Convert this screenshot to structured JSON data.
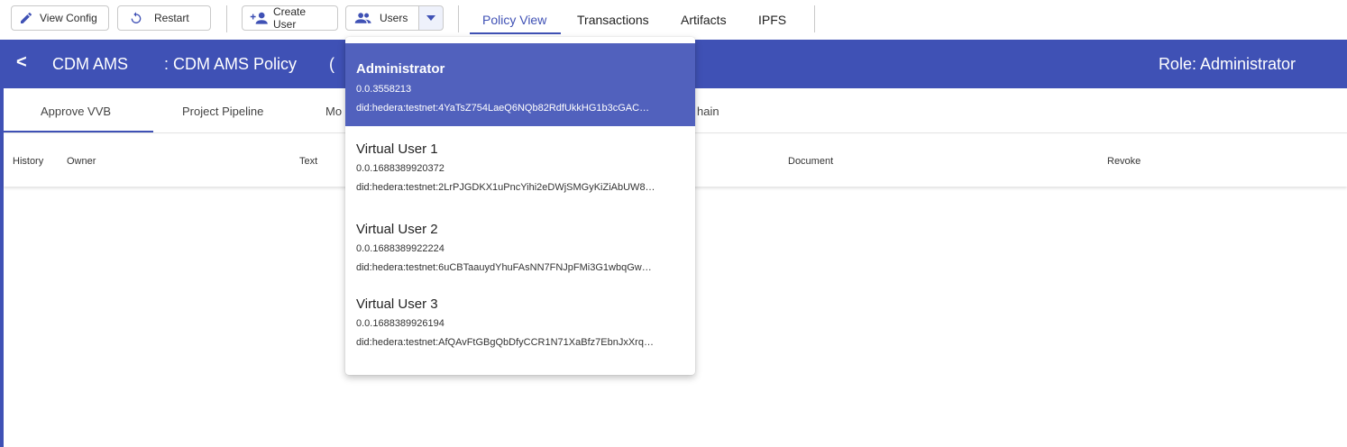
{
  "toolbar": {
    "view_config": "View Config",
    "restart": "Restart",
    "create_user": "Create User",
    "users": "Users",
    "nav": [
      "Policy View",
      "Transactions",
      "Artifacts",
      "IPFS"
    ],
    "active_nav": "Policy View"
  },
  "policy_bar": {
    "back": "<",
    "name": "CDM AMS",
    "policy": ": CDM AMS Policy",
    "paren": "(",
    "role": "Role: Administrator"
  },
  "tabs": [
    "Approve VVB",
    "Project Pipeline",
    "Mo",
    "hain"
  ],
  "table_headers": [
    "History",
    "Owner",
    "Text",
    "Document",
    "Revoke"
  ],
  "users_dropdown": [
    {
      "name": "Administrator",
      "account": "0.0.3558213",
      "did": "did:hedera:testnet:4YaTsZ754LaeQ6NQb82RdfUkkHG1b3cGAC…"
    },
    {
      "name": "Virtual User 1",
      "account": "0.0.1688389920372",
      "did": "did:hedera:testnet:2LrPJGDKX1uPncYihi2eDWjSMGyKiZiAbUW8…"
    },
    {
      "name": "Virtual User 2",
      "account": "0.0.1688389922224",
      "did": "did:hedera:testnet:6uCBTaauydYhuFAsNN7FNJpFMi3G1wbqGw…"
    },
    {
      "name": "Virtual User 3",
      "account": "0.0.1688389926194",
      "did": "did:hedera:testnet:AfQAvFtGBgQbDfyCCR1N71XaBfz7EbnJxXrq…"
    }
  ],
  "colors": {
    "primary": "#3f51b5",
    "selected": "#5161bd"
  }
}
